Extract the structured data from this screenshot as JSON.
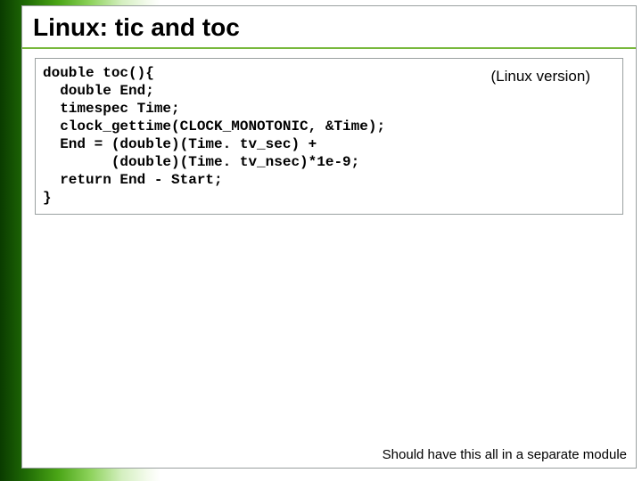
{
  "title": "Linux: tic and toc",
  "code_box": {
    "annotation": "(Linux version)",
    "lines": [
      "double toc(){",
      "  double End;",
      "  timespec Time;",
      "  clock_gettime(CLOCK_MONOTONIC, &Time);",
      "  End = (double)(Time. tv_sec) +",
      "        (double)(Time. tv_nsec)*1e-9;",
      "  return End - Start;",
      "}"
    ]
  },
  "footer_note": "Should have this all in a separate module"
}
